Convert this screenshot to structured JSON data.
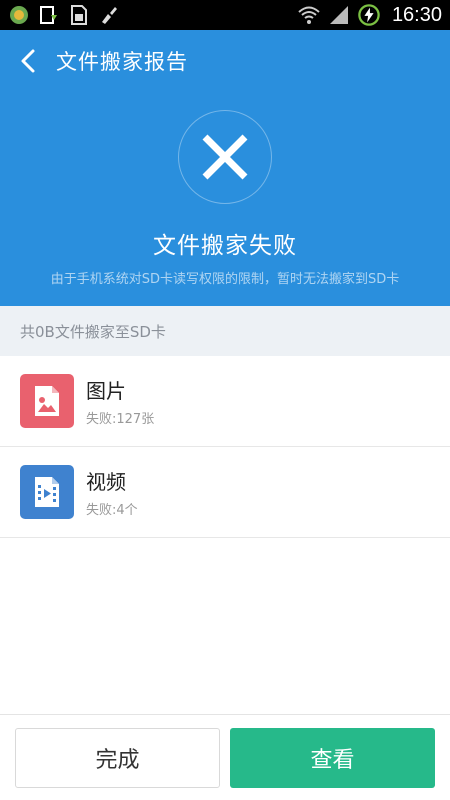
{
  "status_bar": {
    "time": "16:30",
    "left_icons": [
      "app-notification-icon",
      "download-notification-icon",
      "sim-card-icon",
      "cleaner-icon"
    ],
    "right_icons": [
      "wifi-icon",
      "signal-icon",
      "battery-charging-icon"
    ]
  },
  "header": {
    "title": "文件搬家报告",
    "back_icon": "chevron-left-icon",
    "result_icon": "close-icon",
    "result_title": "文件搬家失败",
    "result_desc": "由于手机系统对SD卡读写权限的限制，暂时无法搬家到SD卡"
  },
  "summary": {
    "text": "共0B文件搬家至SD卡"
  },
  "items": [
    {
      "name": "图片",
      "status": "失败:127张",
      "icon": "image-icon",
      "color": "#e9616e"
    },
    {
      "name": "视频",
      "status": "失败:4个",
      "icon": "video-icon",
      "color": "#3f82cf"
    }
  ],
  "buttons": {
    "done_label": "完成",
    "view_label": "查看"
  },
  "colors": {
    "header_bg": "#2a8fdd",
    "primary_button": "#26b98a",
    "summary_bg": "#edf1f5"
  }
}
